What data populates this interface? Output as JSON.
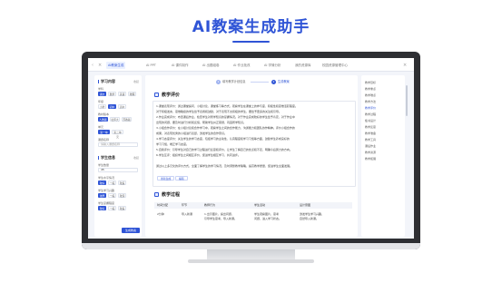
{
  "hero": {
    "title": "AI教案生成助手"
  },
  "tabs": [
    {
      "label": "AI教案生成"
    },
    {
      "label": "AI PPT"
    },
    {
      "label": "AI 课件制作"
    },
    {
      "label": "AI 出题组卷"
    },
    {
      "label": "AI 作业批改"
    },
    {
      "label": "AI 学情分析"
    },
    {
      "label": "我的资源库"
    },
    {
      "label": "校园资源管理中心"
    }
  ],
  "steps": [
    {
      "index": "1",
      "label": "填写教学计划信息"
    },
    {
      "index": "2",
      "label": "生成教案"
    }
  ],
  "left": {
    "section1_title": "学习内容",
    "section1_link": "收起",
    "subject_label": "学科",
    "subject_options": [
      "语文",
      "数学",
      "英语",
      "物理",
      "化学",
      "生物"
    ],
    "grade_label": "年级",
    "grade_options": [
      "小学",
      "初中",
      "高中",
      "大学"
    ],
    "version_label": "教材版本",
    "version_options": [
      "人教版",
      "北师大",
      "苏教版"
    ],
    "unit_label": "单元",
    "unit_options": [
      "第一单元",
      "第二单元"
    ],
    "topic_label": "课题名称",
    "topic_placeholder": "请输入课题名称",
    "section2_title": "学生信息",
    "section2_link": "收起",
    "count_label": "学生数量",
    "count_value": "45",
    "level_label": "学生水平情况",
    "level_options": [
      "较好",
      "一般",
      "较差"
    ],
    "learn_label": "学生学习兴趣",
    "learn_options": [
      "浓厚",
      "一般",
      "较弱"
    ],
    "ability_label": "学生掌握程度",
    "ability_options": [
      "较好",
      "一般",
      "较差"
    ],
    "generate_button": "生成教案"
  },
  "main": {
    "eval_title": "教学评价",
    "eval_lines": [
      "1.课堂表现评价：通过课堂提问、小组讨论、课堂练习等方式，观察学生在课堂上的参与度、积极性和思维活跃程度。",
      "  对于积极发言、思维敏捷的学生给予表扬和鼓励，对于表现不太积极的学生，要给予更多的关注和引导。",
      "2.作业完成评价：布置课后作业，检查学生对所学知识的掌握情况。对于作业完成较好的学生给予肯定，对于作业中",
      "  出现的问题，要及时进行分析和反馈，帮助学生纠正错误，巩固所学知识。",
      "3.小组合作评价：在小组讨论和合作学习中，观察学生之间的合作能力、沟通能力和团队协作精神。评价小组合作的",
      "  成果，对表现优秀的小组进行表彰，激发学生的合作意识。",
      "4.学习态度评价：关注学生的学习态度，包括学习的主动性、认真程度和学习习惯等方面，鼓励学生养成良好的",
      "  学习习惯，端正学习态度。",
      "5.自我评价：引导学生对自己的学习过程进行反思和评价，让学生了解自己的优点和不足，明确今后努力的方向。",
      "6.学生互评：组织学生之间相互评价，促进学生相互学习、共同进步。",
      "",
      "通过以上多元化的评价方式，全面了解学生的学习情况，及时调整教学策略，提高教学质量，促进学生全面发展。"
    ],
    "regen_button": "重新生成",
    "edit_button": "编辑",
    "process_title": "教学过程",
    "table_headers": [
      "时间分配",
      "环节",
      "教师行为",
      "学生活动",
      "设计意图"
    ],
    "table_rows": [
      [
        "2分钟",
        "导入新课",
        "1.出示图片，提出问题，",
        "学生观察图片，思考",
        "激发学生学习兴趣，"
      ],
      [
        "",
        "",
        "引导学生思考，导入新课。",
        "问题，进入学习状态。",
        "自然导入新课。"
      ]
    ]
  },
  "toc": {
    "items": [
      "教学目标",
      "教学重点",
      "教学难点",
      "教学方法",
      "教学评价",
      "教学过程",
      "板书设计",
      "教学反思",
      "教学准备",
      "教学工具",
      "课后作业",
      "教学资源",
      "教学拓展"
    ],
    "active_index": 4
  },
  "colors": {
    "accent": "#2f54d6"
  }
}
